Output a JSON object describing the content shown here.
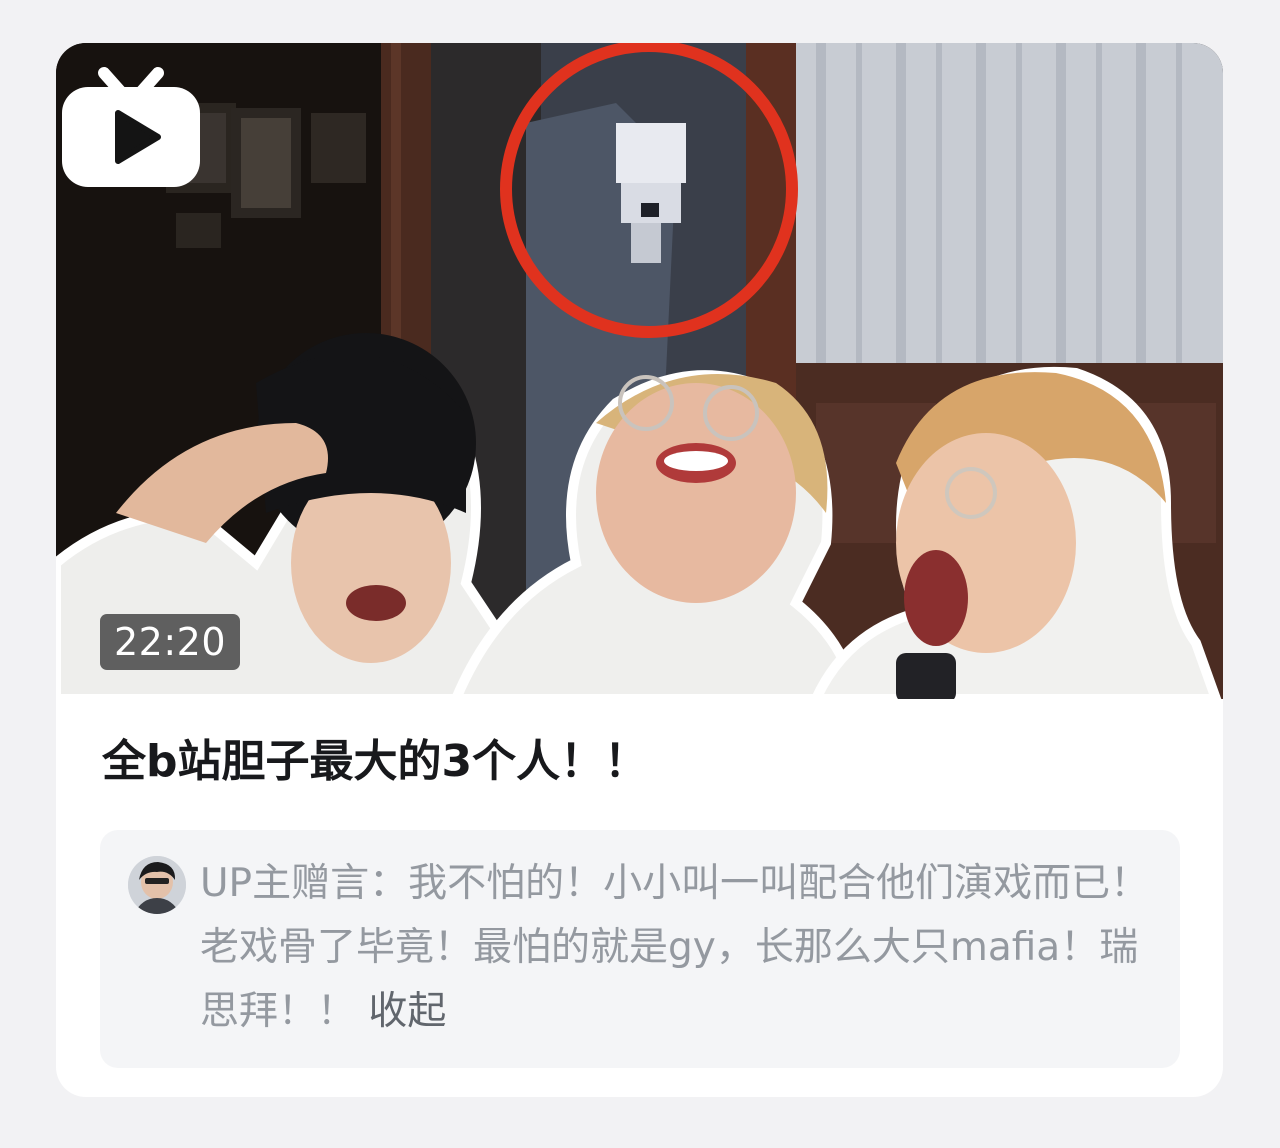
{
  "video": {
    "duration": "22:20",
    "title": "全b站胆子最大的3个人！！",
    "thumbnail_icon": "bilibili-tv-play-icon"
  },
  "up_note": {
    "prefix": "UP主赠言：",
    "text": "我不怕的！小小叫一叫配合他们演戏而已！老戏骨了毕竟！最怕的就是gy，长那么大只mafia！瑞思拜！！",
    "collapse_label": "收起"
  },
  "colors": {
    "accent_circle": "#e0321e",
    "title": "#18191c",
    "note_text": "#9499a0",
    "collapse": "#61666d"
  }
}
